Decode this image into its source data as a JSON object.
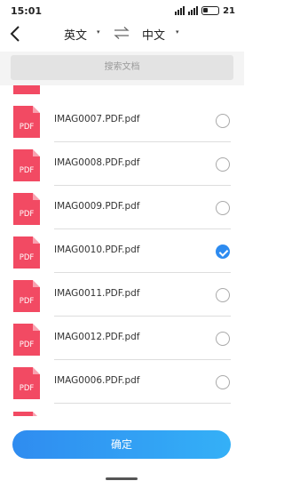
{
  "status_bar": {
    "time": "15:01",
    "battery": "21"
  },
  "header": {
    "from_lang": "英文",
    "to_lang": "中文",
    "caret": "▾"
  },
  "search": {
    "placeholder": "搜索文档"
  },
  "files": [
    {
      "name": "IMAG0007.PDF.pdf",
      "selected": false
    },
    {
      "name": "IMAG0008.PDF.pdf",
      "selected": false
    },
    {
      "name": "IMAG0009.PDF.pdf",
      "selected": false
    },
    {
      "name": "IMAG0010.PDF.pdf",
      "selected": true
    },
    {
      "name": "IMAG0011.PDF.pdf",
      "selected": false
    },
    {
      "name": "IMAG0012.PDF.pdf",
      "selected": false
    },
    {
      "name": "IMAG0006.PDF.pdf",
      "selected": false
    }
  ],
  "file_icon_label": "PDF",
  "confirm_label": "确定",
  "colors": {
    "accent": "#2d8bf0",
    "pdf_icon": "#f24a63"
  },
  "icons": {
    "back": "chevron-left-icon",
    "swap": "swap-arrows-icon",
    "file": "pdf-file-icon",
    "selected": "check-circle-icon"
  }
}
